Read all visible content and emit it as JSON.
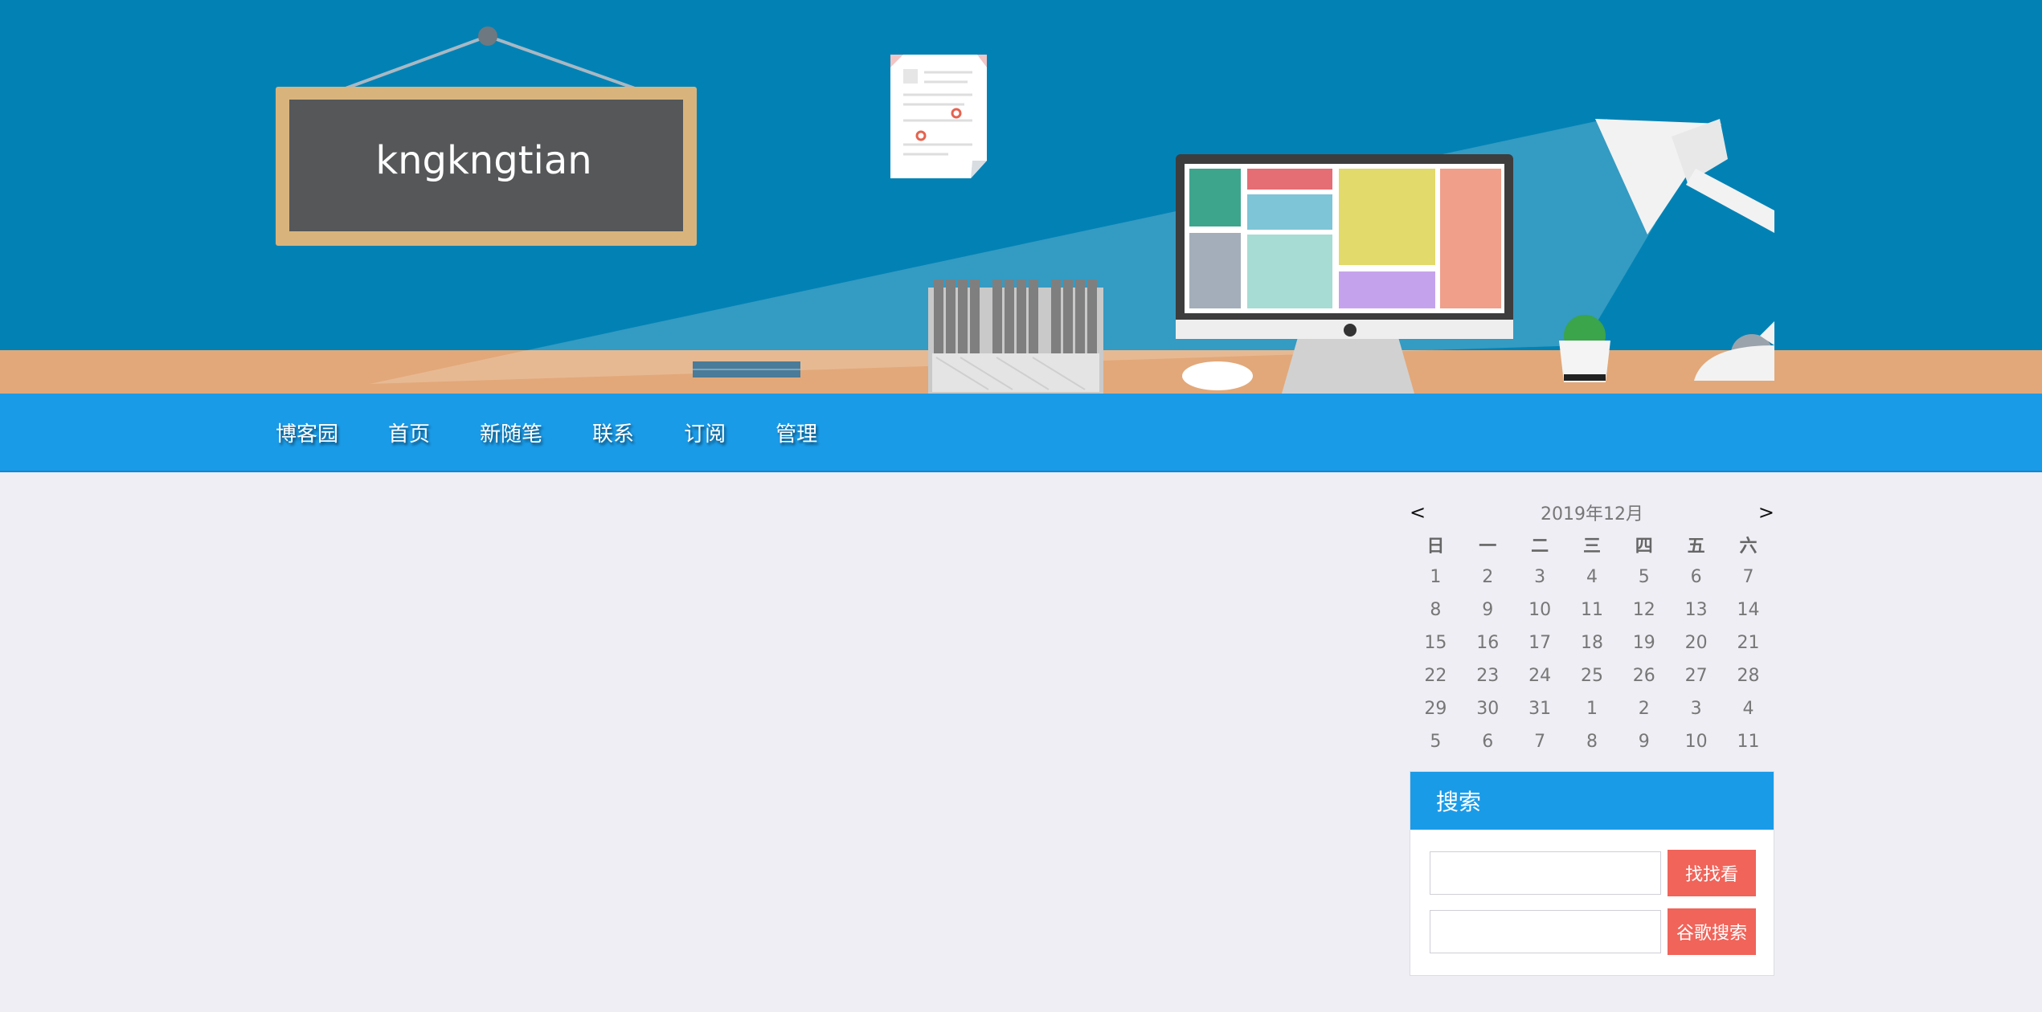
{
  "header": {
    "blog_title": "kngkngtian"
  },
  "nav": {
    "items": [
      {
        "label": "博客园"
      },
      {
        "label": "首页"
      },
      {
        "label": "新随笔"
      },
      {
        "label": "联系"
      },
      {
        "label": "订阅"
      },
      {
        "label": "管理"
      }
    ]
  },
  "calendar": {
    "prev": "<",
    "next": ">",
    "title": "2019年12月",
    "weekdays": [
      "日",
      "一",
      "二",
      "三",
      "四",
      "五",
      "六"
    ],
    "weeks": [
      [
        "1",
        "2",
        "3",
        "4",
        "5",
        "6",
        "7"
      ],
      [
        "8",
        "9",
        "10",
        "11",
        "12",
        "13",
        "14"
      ],
      [
        "15",
        "16",
        "17",
        "18",
        "19",
        "20",
        "21"
      ],
      [
        "22",
        "23",
        "24",
        "25",
        "26",
        "27",
        "28"
      ],
      [
        "29",
        "30",
        "31",
        "1",
        "2",
        "3",
        "4"
      ],
      [
        "5",
        "6",
        "7",
        "8",
        "9",
        "10",
        "11"
      ]
    ]
  },
  "search": {
    "title": "搜索",
    "site_button": "找找看",
    "google_button": "谷歌搜索",
    "site_value": "",
    "google_value": ""
  },
  "colors": {
    "sky": "#0282b4",
    "desk": "#e2a879",
    "nav": "#1a9be8",
    "search_button": "#f0645a",
    "page_bg": "#eeeef4"
  }
}
